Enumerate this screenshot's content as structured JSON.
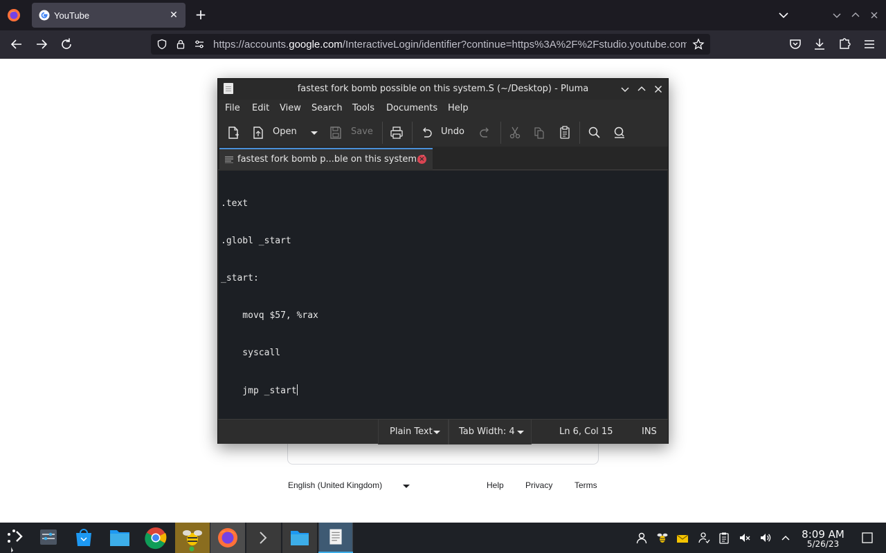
{
  "browser": {
    "tab_title": "YouTube",
    "url_prefix": "https://accounts.",
    "url_domain": "google.com",
    "url_rest": "/InteractiveLogin/identifier?continue=https%3A%2F%2Fstudio.youtube.com"
  },
  "page": {
    "language": "English (United Kingdom)",
    "footer_links": [
      "Help",
      "Privacy",
      "Terms"
    ]
  },
  "pluma": {
    "window_title": "fastest fork bomb possible on this system.S (~/Desktop) - Pluma",
    "menus": [
      "File",
      "Edit",
      "View",
      "Search",
      "Tools",
      "Documents",
      "Help"
    ],
    "toolbar": {
      "open_label": "Open",
      "save_label": "Save",
      "undo_label": "Undo"
    },
    "doc_tab_title": "fastest fork bomb p...ble on this system.S",
    "code_lines": [
      ".text",
      ".globl _start",
      "_start:",
      "    movq $57, %rax",
      "    syscall",
      "    jmp _start"
    ],
    "status": {
      "language": "Plain Text",
      "tab_width": "Tab Width:  4",
      "position": "Ln 6, Col 15",
      "mode": "INS"
    }
  },
  "taskbar": {
    "time": "8:09 AM",
    "date": "5/26/23"
  },
  "colors": {
    "accent": "#3daee9",
    "tab_close": "#d94452",
    "editor_bg": "#1c1f24"
  }
}
